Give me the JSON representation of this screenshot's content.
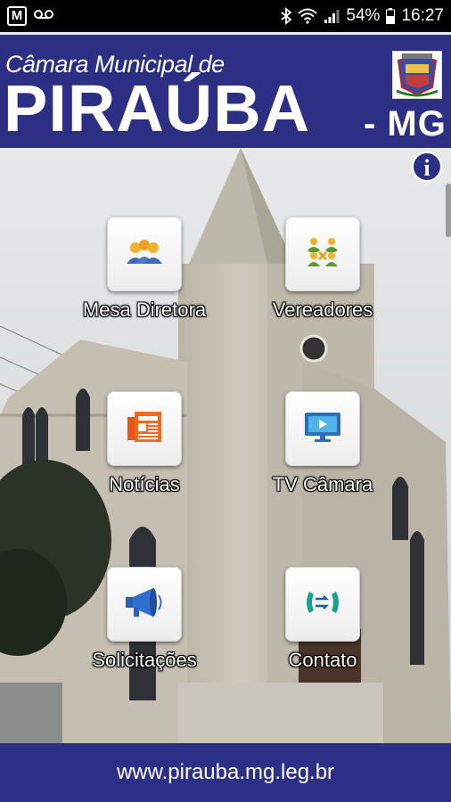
{
  "status_bar": {
    "left_icons": [
      "m-app-icon",
      "voicemail-icon"
    ],
    "m_letter": "M",
    "battery": "54%",
    "time": "16:27",
    "right_icons": [
      "bluetooth-icon",
      "wifi-icon",
      "signal-icon",
      "battery-icon"
    ]
  },
  "header": {
    "subtitle": "Câmara Municipal de",
    "title": "PIRAÚBA",
    "state": "- MG",
    "colors": {
      "background": "#2d2f85",
      "text": "#ffffff"
    }
  },
  "info_button": {
    "label": "i",
    "icon": "info-icon"
  },
  "menu": {
    "items": [
      {
        "label": "Mesa Diretora",
        "icon": "group-people-icon"
      },
      {
        "label": "Vereadores",
        "icon": "councilors-icon"
      },
      {
        "label": "Notícias",
        "icon": "newspaper-icon"
      },
      {
        "label": "TV Câmara",
        "icon": "monitor-icon"
      },
      {
        "label": "Solicitações",
        "icon": "megaphone-icon"
      },
      {
        "label": "Contato",
        "icon": "phone-transfer-icon"
      }
    ]
  },
  "footer": {
    "url": "www.pirauba.mg.leg.br"
  }
}
